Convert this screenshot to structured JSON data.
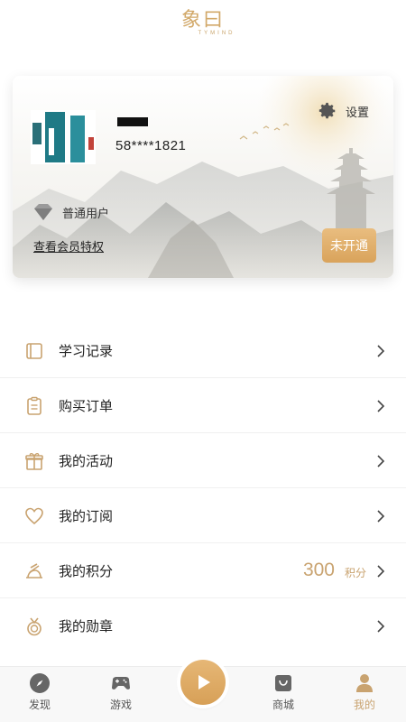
{
  "header": {
    "logo_text": "象曰",
    "logo_sub": "TYMIND"
  },
  "card": {
    "phone": "58****1821",
    "settings_label": "设置",
    "level_label": "普通用户",
    "view_privileges": "查看会员特权",
    "open_button": "未开通"
  },
  "menu": {
    "items": [
      {
        "label": "学习记录",
        "icon": "book-icon"
      },
      {
        "label": "购买订单",
        "icon": "clipboard-icon"
      },
      {
        "label": "我的活动",
        "icon": "gift-icon"
      },
      {
        "label": "我的订阅",
        "icon": "heart-icon"
      },
      {
        "label": "我的积分",
        "icon": "points-icon",
        "value": "300",
        "unit": "积分"
      },
      {
        "label": "我的勋章",
        "icon": "medal-icon"
      }
    ]
  },
  "tabbar": {
    "tabs": [
      {
        "label": "发现",
        "icon": "compass-icon"
      },
      {
        "label": "游戏",
        "icon": "gamepad-icon"
      },
      {
        "label": "",
        "icon": "play-icon"
      },
      {
        "label": "商城",
        "icon": "bag-icon"
      },
      {
        "label": "我的",
        "icon": "user-icon",
        "active": true
      }
    ]
  },
  "colors": {
    "accent": "#c9a370",
    "button": "#dba45d",
    "text": "#222222"
  }
}
